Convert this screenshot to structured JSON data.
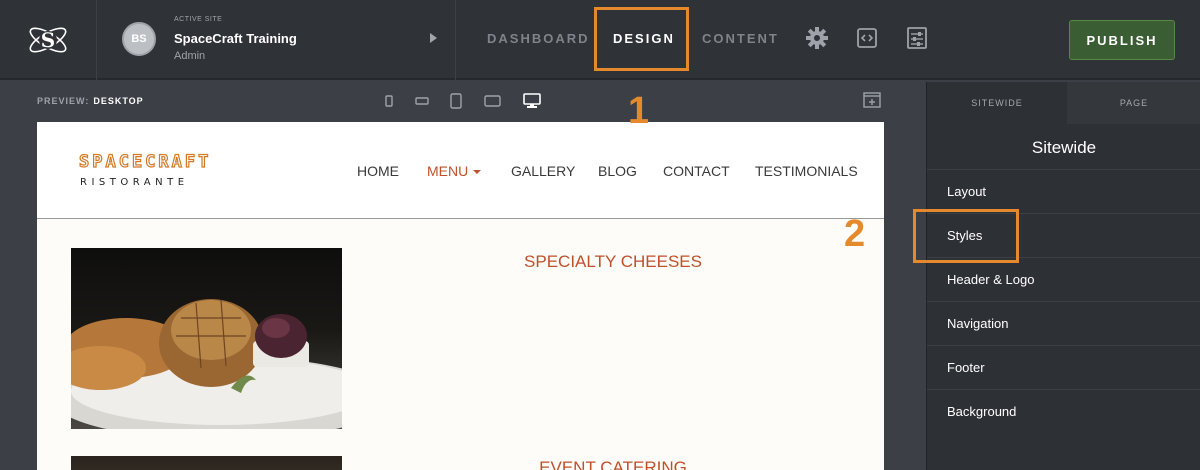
{
  "topbar": {
    "site": {
      "avatar_initials": "BS",
      "label": "ACTIVE SITE",
      "name": "SpaceCraft Training",
      "role": "Admin"
    },
    "tabs": [
      {
        "label": "DASHBOARD",
        "active": false
      },
      {
        "label": "DESIGN",
        "active": true
      },
      {
        "label": "CONTENT",
        "active": false
      }
    ],
    "tools": [
      "gear-icon",
      "code-icon",
      "sliders-icon"
    ],
    "publish_label": "PUBLISH"
  },
  "preview": {
    "label": "PREVIEW:",
    "mode": "DESKTOP",
    "devices": [
      "phone-portrait",
      "phone-landscape",
      "tablet-portrait",
      "tablet-landscape",
      "desktop"
    ],
    "active_device": "desktop"
  },
  "site": {
    "brand_top": "SPACECRAFT",
    "brand_bottom": "RISTORANTE",
    "nav": [
      {
        "label": "HOME",
        "active": false
      },
      {
        "label": "MENU",
        "active": true
      },
      {
        "label": "GALLERY",
        "active": false
      },
      {
        "label": "BLOG",
        "active": false
      },
      {
        "label": "CONTACT",
        "active": false
      },
      {
        "label": "TESTIMONIALS",
        "active": false
      }
    ],
    "sections": [
      {
        "title": "SPECIALTY CHEESES"
      },
      {
        "title": "EVENT CATERING"
      }
    ]
  },
  "panel": {
    "tabs": [
      {
        "label": "SITEWIDE",
        "active": true
      },
      {
        "label": "PAGE",
        "active": false
      }
    ],
    "title": "Sitewide",
    "items": [
      {
        "label": "Layout"
      },
      {
        "label": "Styles"
      },
      {
        "label": "Header & Logo"
      },
      {
        "label": "Navigation"
      },
      {
        "label": "Footer"
      },
      {
        "label": "Background"
      }
    ]
  },
  "callouts": [
    "1",
    "2"
  ],
  "colors": {
    "accent_orange": "#e48a2c",
    "brand_red": "#c0502a",
    "publish_green": "#3b5d33"
  }
}
